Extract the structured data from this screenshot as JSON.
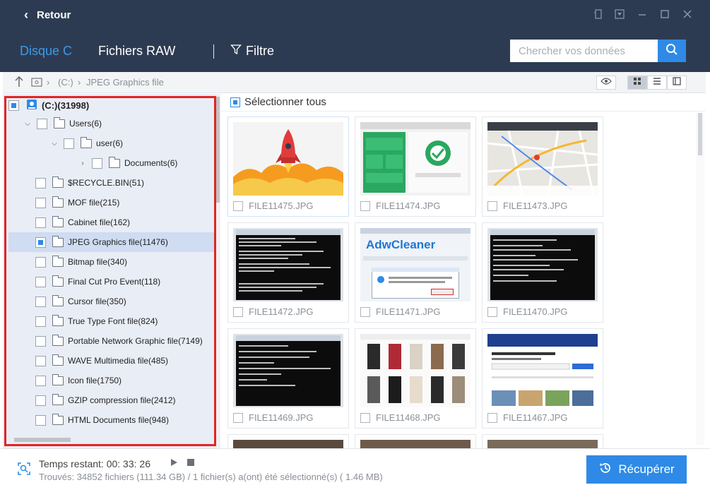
{
  "titlebar": {
    "back_label": "Retour"
  },
  "header": {
    "tab_disk": "Disque C",
    "tab_raw": "Fichiers RAW",
    "filter_label": "Filtre",
    "search_placeholder": "Chercher vos données"
  },
  "pathbar": {
    "drive": "(C:)",
    "folder": "JPEG Graphics file"
  },
  "tree": {
    "root": "(C:)(31998)",
    "users": "Users(6)",
    "user": "user(6)",
    "documents": "Documents(6)",
    "items": [
      "$RECYCLE.BIN(51)",
      "MOF file(215)",
      "Cabinet file(162)",
      "JPEG Graphics file(11476)",
      "Bitmap file(340)",
      "Final Cut Pro Event(118)",
      "Cursor file(350)",
      "True Type Font file(824)",
      "Portable Network Graphic file(7149)",
      "WAVE Multimedia file(485)",
      "Icon file(1750)",
      "GZIP compression file(2412)",
      "HTML Documents file(948)"
    ]
  },
  "grid": {
    "select_all": "Sélectionner tous",
    "files": [
      "FILE11475.JPG",
      "FILE11474.JPG",
      "FILE11473.JPG",
      "FILE11472.JPG",
      "FILE11471.JPG",
      "FILE11470.JPG",
      "FILE11469.JPG",
      "FILE11468.JPG",
      "FILE11467.JPG"
    ],
    "adw_logo": "AdwCleaner"
  },
  "footer": {
    "time_remaining": "Temps restant: 00: 33: 26",
    "found": "Trouvés: 34852 fichiers (111.34 GB) / 1 fichier(s) a(ont) été sélectionné(s) ( 1.46 MB)",
    "recover_label": "Récupérer"
  },
  "colors": {
    "accent": "#2e8ae6",
    "header_bg": "#2d3b52",
    "highlight_frame": "#e12525"
  }
}
